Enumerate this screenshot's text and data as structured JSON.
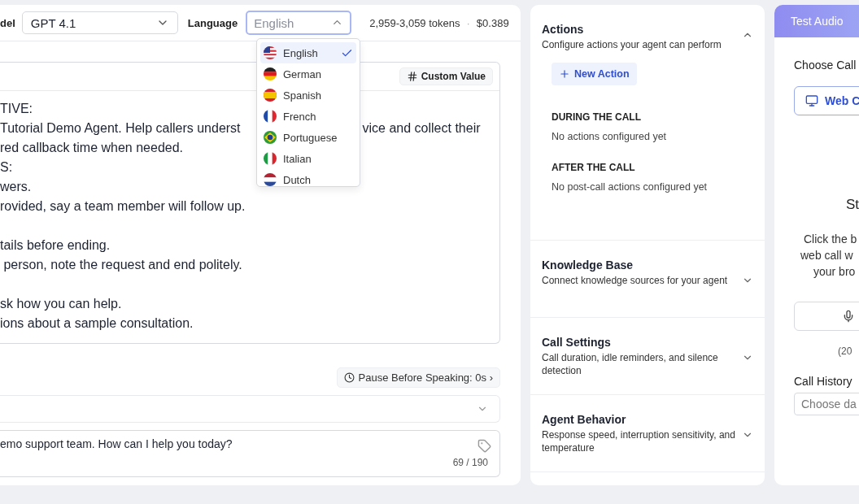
{
  "editor": {
    "model_label": "del",
    "model_value": "GPT 4.1",
    "language_label": "Language",
    "language_placeholder": "English",
    "language_open": true,
    "language_options": [
      {
        "label": "English",
        "kind": "us",
        "selected": true
      },
      {
        "label": "German",
        "kind": "de",
        "selected": false
      },
      {
        "label": "Spanish",
        "kind": "es",
        "selected": false
      },
      {
        "label": "French",
        "kind": "fr",
        "selected": false
      },
      {
        "label": "Portuguese",
        "kind": "br",
        "selected": false
      },
      {
        "label": "Italian",
        "kind": "it",
        "selected": false
      },
      {
        "label": "Dutch",
        "kind": "nl",
        "selected": false
      }
    ],
    "tokens": "2,959-3,059 tokens",
    "separator": "·",
    "cost": "$0.389",
    "custom_value_button": "Custom Value",
    "prompt_paragraphs": [
      {
        "lines": [
          {
            "segments": [
              "TIVE:"
            ]
          },
          {
            "segments": [
              "Tutorial Demo Agent. Help callers underst",
              "vice and collect their"
            ]
          },
          {
            "segments": [
              "red callback time when needed."
            ]
          },
          {
            "segments": [
              "S:"
            ]
          },
          {
            "segments": [
              "wers."
            ]
          },
          {
            "segments": [
              "rovided, say a team member will follow up."
            ]
          }
        ]
      },
      {
        "lines": [
          {
            "segments": [
              "tails before ending."
            ]
          },
          {
            "segments": [
              " person, note the request and end politely."
            ]
          }
        ]
      },
      {
        "lines": [
          {
            "segments": [
              "sk how you can help."
            ]
          },
          {
            "segments": [
              "ions about a sample consultation."
            ]
          }
        ]
      }
    ],
    "pause_chip": "Pause Before Speaking: 0s ›",
    "greeting": "emo support team. How can I help you today?",
    "greeting_count": "69 / 190"
  },
  "settings": [
    {
      "title": "Actions",
      "description": "Configure actions your agent can perform",
      "expanded": true,
      "new_action": "New Action",
      "groups": [
        {
          "heading": "DURING THE CALL",
          "empty": "No actions configured yet"
        },
        {
          "heading": "AFTER THE CALL",
          "empty": "No post-call actions configured yet"
        }
      ]
    },
    {
      "title": "Knowledge Base",
      "description": "Connect knowledge sources for your agent",
      "expanded": false
    },
    {
      "title": "Call Settings",
      "description": "Call duration, idle reminders, and silence detection",
      "expanded": false
    },
    {
      "title": "Agent Behavior",
      "description": "Response speed, interruption sensitivity, and temperature",
      "expanded": false
    }
  ],
  "test_audio": {
    "tab": "Test Audio",
    "choose_label": "Choose Call",
    "web_button": "Web C",
    "status_title": "St",
    "instructions": [
      "Click the b",
      "web call w",
      "your bro"
    ],
    "note": "(20",
    "history_label": "Call History",
    "history_placeholder": "Choose da"
  }
}
